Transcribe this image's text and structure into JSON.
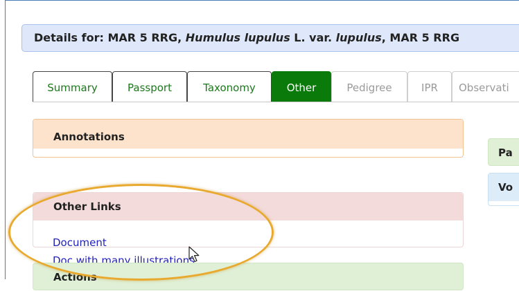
{
  "header": {
    "prefix": "Details for: MAR 5 RRG, ",
    "species": "Humulus lupulus",
    "mid": " L. var. ",
    "variety": "lupulus",
    "suffix": ", MAR 5 RRG"
  },
  "tabs": [
    {
      "label": "Summary",
      "state": "normal"
    },
    {
      "label": "Passport",
      "state": "normal"
    },
    {
      "label": "Taxonomy",
      "state": "normal"
    },
    {
      "label": "Other",
      "state": "active"
    },
    {
      "label": "Pedigree",
      "state": "disabled"
    },
    {
      "label": "IPR",
      "state": "disabled"
    },
    {
      "label": "Observati",
      "state": "disabled"
    }
  ],
  "panels": {
    "annotations": {
      "title": "Annotations"
    },
    "other_links": {
      "title": "Other Links",
      "links": [
        "Document",
        "Doc with many illustrations"
      ]
    },
    "actions": {
      "title": "Actions"
    },
    "right_panel_1": {
      "title": "Pa"
    },
    "right_panel_2": {
      "title": "Vo"
    }
  },
  "colors": {
    "accent_green": "#0a7a0a",
    "link_blue": "#2222bb",
    "highlight_ellipse": "#e8a92e"
  }
}
